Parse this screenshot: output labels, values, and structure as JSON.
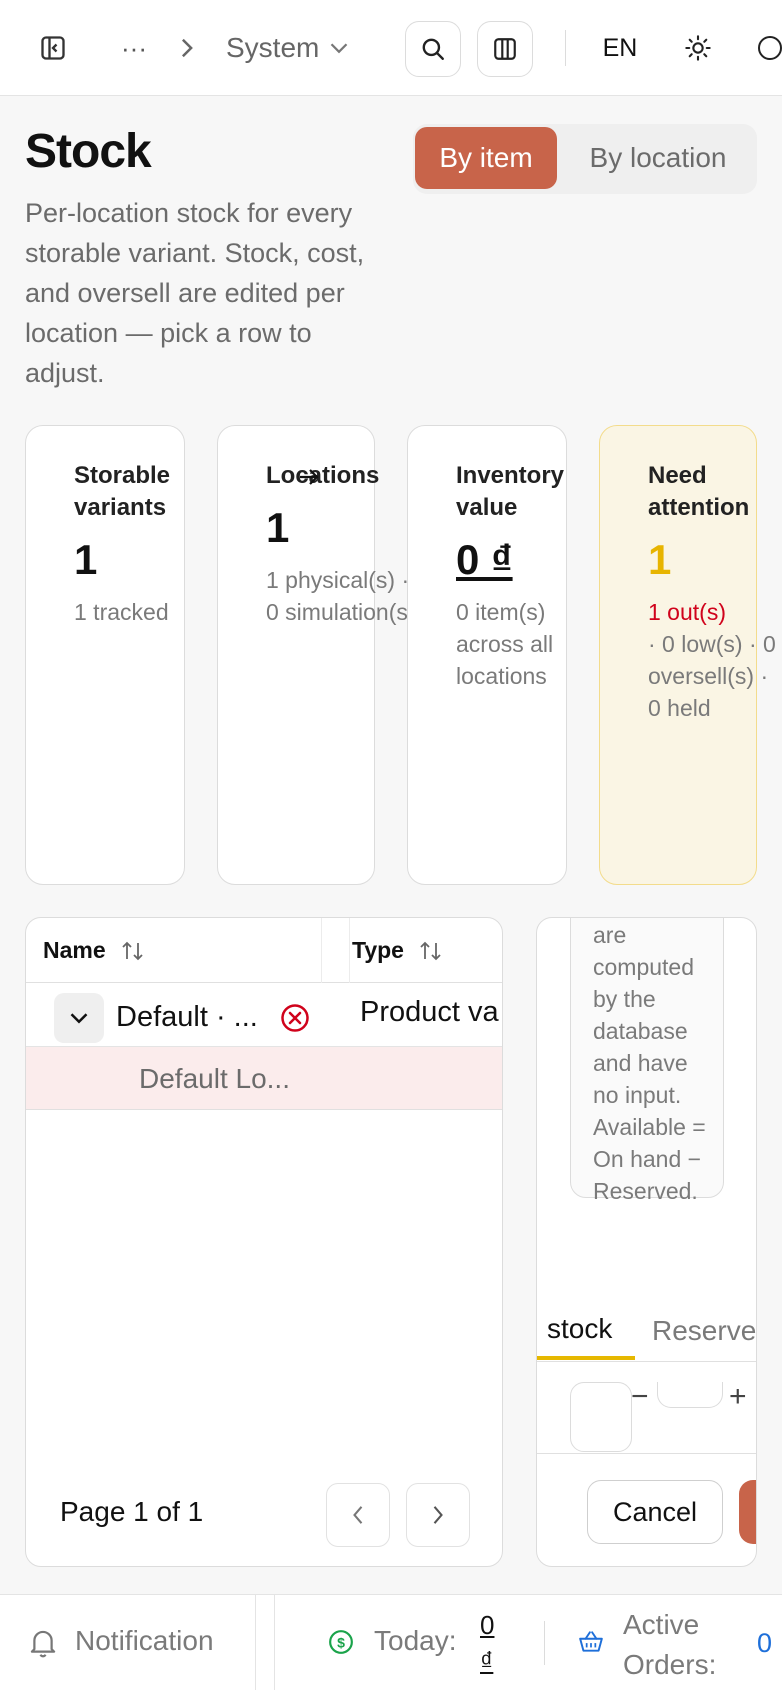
{
  "topbar": {
    "breadcrumb_more": "···",
    "breadcrumb_current": "System",
    "language": "EN"
  },
  "header": {
    "title": "Stock",
    "description": "Per-location stock for every storable variant. Stock, cost, and oversell are edited per location — pick a row to adjust.",
    "view_toggle": {
      "by_item": "By item",
      "by_location": "By location",
      "active": "By item"
    }
  },
  "cards": [
    {
      "label": "Storable variants",
      "value": "1",
      "sub": "1 tracked"
    },
    {
      "label": "Locations",
      "value": "1",
      "sub": "1 physical(s) · 0 simulation(s)"
    },
    {
      "label": "Inventory value",
      "value": "0 ₫",
      "sub": "0 item(s) across all locations"
    },
    {
      "label": "Need attention",
      "value": "1",
      "sub_alert": "1 out(s)",
      "sub": "· 0 low(s) · 0 oversell(s) · 0 held"
    }
  ],
  "table": {
    "columns": [
      {
        "label": "Name"
      },
      {
        "label": "Type"
      }
    ],
    "rows": [
      {
        "name": "Default · ...",
        "type": "Product va",
        "status": "out-of-stock"
      },
      {
        "name": "Default Lo...",
        "type": ""
      }
    ],
    "pagination": "Page 1 of 1"
  },
  "side_panel": {
    "note": "are computed by the database and have no input. Available = On hand − Reserved.",
    "tabs": [
      "stock",
      "Reserve"
    ],
    "active_tab": "stock",
    "stepper_minus": "−",
    "stepper_plus": "+",
    "cancel_label": "Cancel"
  },
  "footer": {
    "notification_label": "Notification",
    "today_label": "Today:",
    "today_value": "0 ₫",
    "orders_label": "Active Orders:",
    "orders_value": "0"
  },
  "colors": {
    "accent": "#c8644a",
    "warning_bg": "#faf5e4",
    "warning_border": "#f3dc8c",
    "warning_value": "#e7b400",
    "alert_red": "#d0021b",
    "tab_underline": "#e6b800",
    "link_blue": "#1e6fd9",
    "money_green": "#1aa34a"
  }
}
